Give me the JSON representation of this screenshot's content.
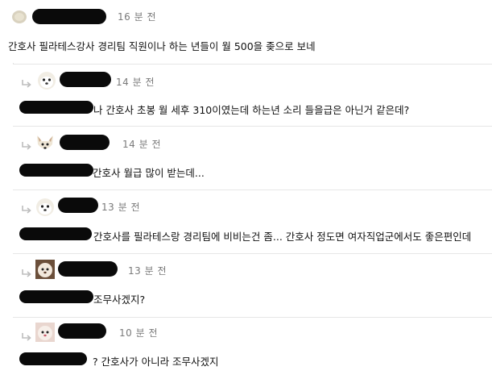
{
  "comments": [
    {
      "time": "16 분 전",
      "text": "간호사 필라테스강사 경리팀 직원이나 하는 년들이 월 500을 좆으로 보네"
    }
  ],
  "replies": [
    {
      "time": "14 분 전",
      "text": "나 간호사 초봉 월 세후 310이였는데 하는년 소리 들을급은 아닌거 같은데?"
    },
    {
      "time": "14 분 전",
      "text": "간호사 월급 많이 받는데..."
    },
    {
      "time": "13 분 전",
      "text": "간호사를 필라테스랑 경리팀에 비비는건 좀... 간호사 정도면 여자직업군에서도 좋은편인데"
    },
    {
      "time": "13 분 전",
      "text": "조무사겠지?"
    },
    {
      "time": "10 분 전",
      "text": "? 간호사가 아니라 조무사겠지"
    }
  ],
  "icons": {
    "reply_arrow": "reply-arrow-icon",
    "avatar": "user-avatar-icon"
  },
  "colors": {
    "redaction": "#0a0a0a",
    "time_text": "#7a7a7a",
    "divider": "#e6e6e6"
  }
}
